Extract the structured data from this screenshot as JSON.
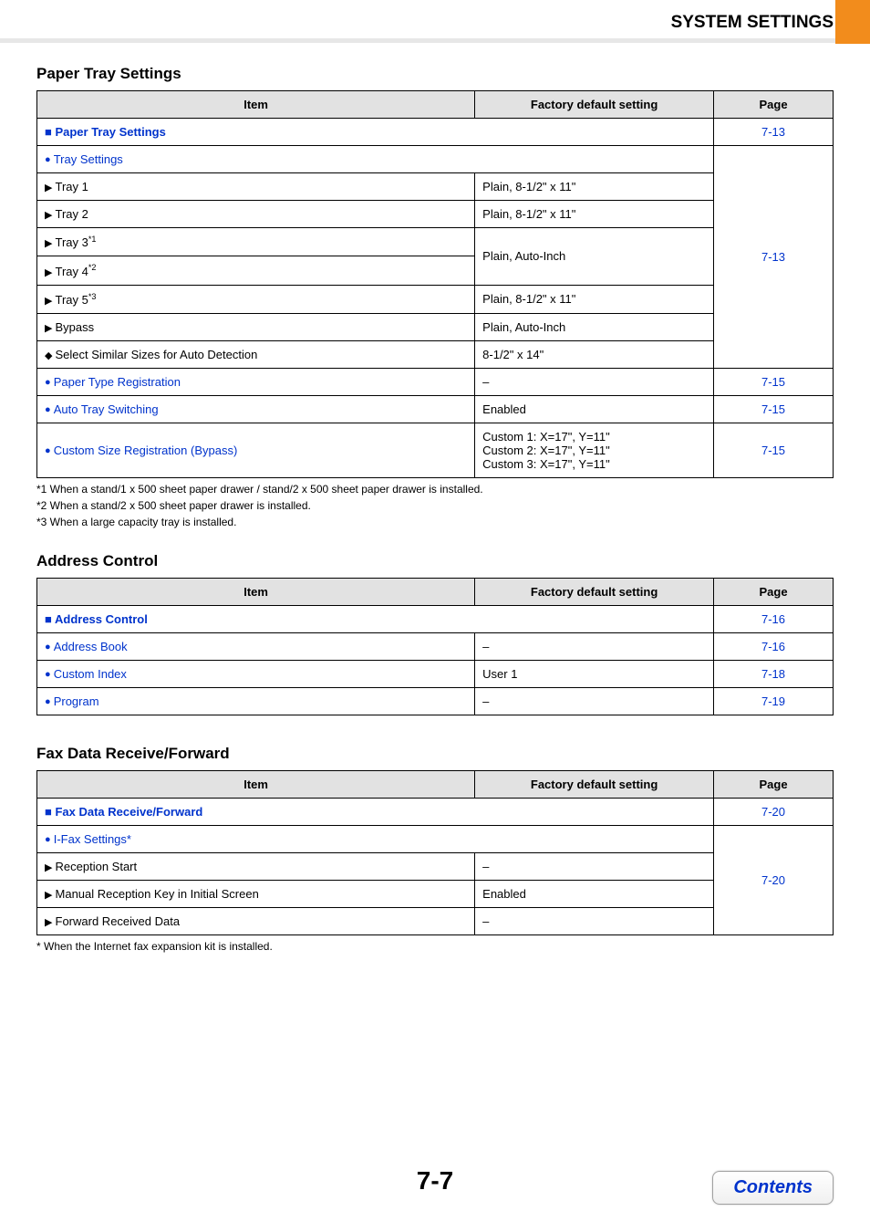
{
  "header": {
    "title": "SYSTEM SETTINGS"
  },
  "footer": {
    "page_number": "7-7",
    "contents_label": "Contents"
  },
  "columns": {
    "item": "Item",
    "fds": "Factory default setting",
    "page": "Page"
  },
  "sections": {
    "paper_tray": {
      "heading": "Paper Tray Settings",
      "root_link": "Paper Tray Settings",
      "root_page": "7-13",
      "tray_settings_link": "Tray Settings",
      "tray_settings_page": "7-13",
      "trays": {
        "tray1": {
          "label": "Tray 1",
          "fds": "Plain, 8-1/2\" x 11\""
        },
        "tray2": {
          "label": "Tray 2",
          "fds": "Plain, 8-1/2\" x 11\""
        },
        "tray3": {
          "label": "Tray 3",
          "sup": "*1"
        },
        "tray4": {
          "label": "Tray 4",
          "sup": "*2"
        },
        "tray34_fds": "Plain, Auto-Inch",
        "tray5": {
          "label": "Tray 5",
          "sup": "*3",
          "fds": "Plain, 8-1/2\" x 11\""
        },
        "bypass": {
          "label": "Bypass",
          "fds": "Plain, Auto-Inch"
        },
        "select_similar": {
          "label": "Select Similar Sizes for Auto Detection",
          "fds": "8-1/2\" x 14\""
        }
      },
      "paper_type_reg": {
        "label": "Paper Type Registration",
        "fds": "–",
        "page": "7-15"
      },
      "auto_tray_switching": {
        "label": "Auto Tray Switching",
        "fds": "Enabled",
        "page": "7-15"
      },
      "custom_size_reg": {
        "label": "Custom Size Registration (Bypass)",
        "fds1": "Custom 1: X=17\", Y=11\"",
        "fds2": "Custom 2: X=17\", Y=11\"",
        "fds3": "Custom 3: X=17\", Y=11\"",
        "page": "7-15"
      },
      "footnotes": {
        "f1": "*1  When a stand/1 x 500 sheet paper drawer / stand/2 x 500 sheet paper drawer is installed.",
        "f2": "*2  When a stand/2 x 500 sheet paper drawer is installed.",
        "f3": "*3  When a large capacity tray is installed."
      }
    },
    "address_control": {
      "heading": "Address Control",
      "root_link": "Address Control",
      "root_page": "7-16",
      "address_book": {
        "label": "Address Book",
        "fds": "–",
        "page": "7-16"
      },
      "custom_index": {
        "label": "Custom Index",
        "fds": "User 1",
        "page": "7-18"
      },
      "program": {
        "label": "Program",
        "fds": "–",
        "page": "7-19"
      }
    },
    "fax": {
      "heading": "Fax Data Receive/Forward",
      "root_link": "Fax Data Receive/Forward",
      "root_page": "7-20",
      "ifax_link": "I-Fax Settings",
      "ifax_star": "*",
      "ifax_page": "7-20",
      "reception_start": {
        "label": "Reception Start",
        "fds": "–"
      },
      "manual_reception": {
        "label": "Manual Reception Key in Initial Screen",
        "fds": "Enabled"
      },
      "forward_received": {
        "label": "Forward Received Data",
        "fds": "–"
      },
      "footnote": "*  When the Internet fax expansion kit is installed."
    }
  }
}
